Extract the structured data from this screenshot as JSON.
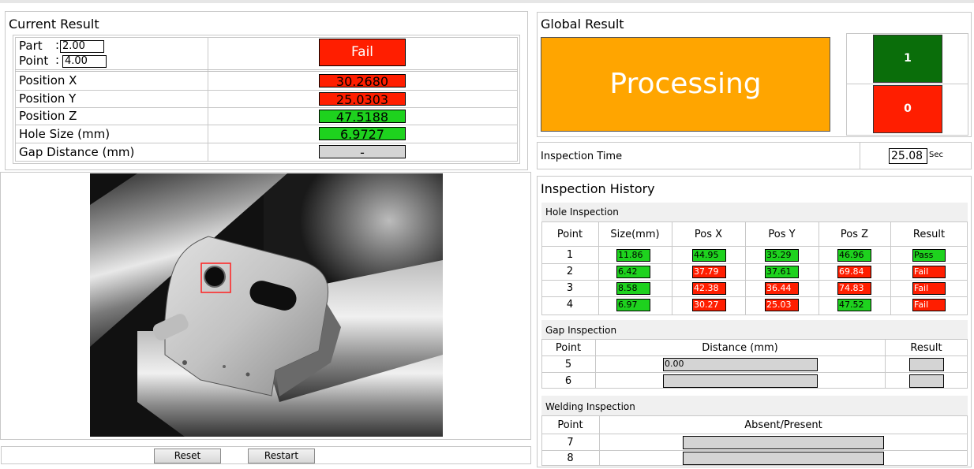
{
  "current_result": {
    "title": "Current Result",
    "part_label": "Part",
    "part_value": "2.00",
    "point_label": "Point",
    "point_value": "4.00",
    "status": "Fail",
    "rows": [
      {
        "label": "Position X",
        "value": "30.2680",
        "state": "red"
      },
      {
        "label": "Position Y",
        "value": "25.0303",
        "state": "red"
      },
      {
        "label": "Position Z",
        "value": "47.5188",
        "state": "green"
      },
      {
        "label": "Hole Size (mm)",
        "value": "6.9727",
        "state": "green"
      },
      {
        "label": "Gap Distance (mm)",
        "value": "-",
        "state": "gray"
      }
    ]
  },
  "global_result": {
    "title": "Global Result",
    "status": "Processing",
    "pass_count": "1",
    "fail_count": "0"
  },
  "inspection_time": {
    "label": "Inspection Time",
    "value": "25.08",
    "unit": "Sec"
  },
  "history": {
    "title": "Inspection History",
    "hole": {
      "title": "Hole Inspection",
      "headers": [
        "Point",
        "Size(mm)",
        "Pos X",
        "Pos Y",
        "Pos Z",
        "Result"
      ],
      "rows": [
        {
          "point": "1",
          "size": "11.86",
          "x": "44.95",
          "y": "35.29",
          "z": "46.96",
          "result": "Pass",
          "states": [
            "green",
            "green",
            "green",
            "green",
            "green"
          ]
        },
        {
          "point": "2",
          "size": "6.42",
          "x": "37.79",
          "y": "37.61",
          "z": "69.84",
          "result": "Fail",
          "states": [
            "green",
            "red",
            "green",
            "red",
            "red"
          ]
        },
        {
          "point": "3",
          "size": "8.58",
          "x": "42.38",
          "y": "36.44",
          "z": "74.83",
          "result": "Fail",
          "states": [
            "green",
            "red",
            "red",
            "red",
            "red"
          ]
        },
        {
          "point": "4",
          "size": "6.97",
          "x": "30.27",
          "y": "25.03",
          "z": "47.52",
          "result": "Fail",
          "states": [
            "green",
            "red",
            "red",
            "green",
            "red"
          ]
        }
      ]
    },
    "gap": {
      "title": "Gap Inspection",
      "headers": [
        "Point",
        "Distance (mm)",
        "Result"
      ],
      "rows": [
        {
          "point": "5",
          "distance": "0.00",
          "result": ""
        },
        {
          "point": "6",
          "distance": "",
          "result": ""
        }
      ]
    },
    "welding": {
      "title": "Welding Inspection",
      "headers": [
        "Point",
        "Absent/Present"
      ],
      "rows": [
        {
          "point": "7",
          "value": ""
        },
        {
          "point": "8",
          "value": ""
        }
      ]
    }
  },
  "buttons": {
    "reset": "Reset",
    "restart": "Restart"
  },
  "colors": {
    "fail_red": "#ff1e00",
    "pass_green": "#1ed21e",
    "processing_orange": "#ffa500",
    "count_green": "#0a6e0a",
    "neutral_gray": "#d4d4d4"
  }
}
